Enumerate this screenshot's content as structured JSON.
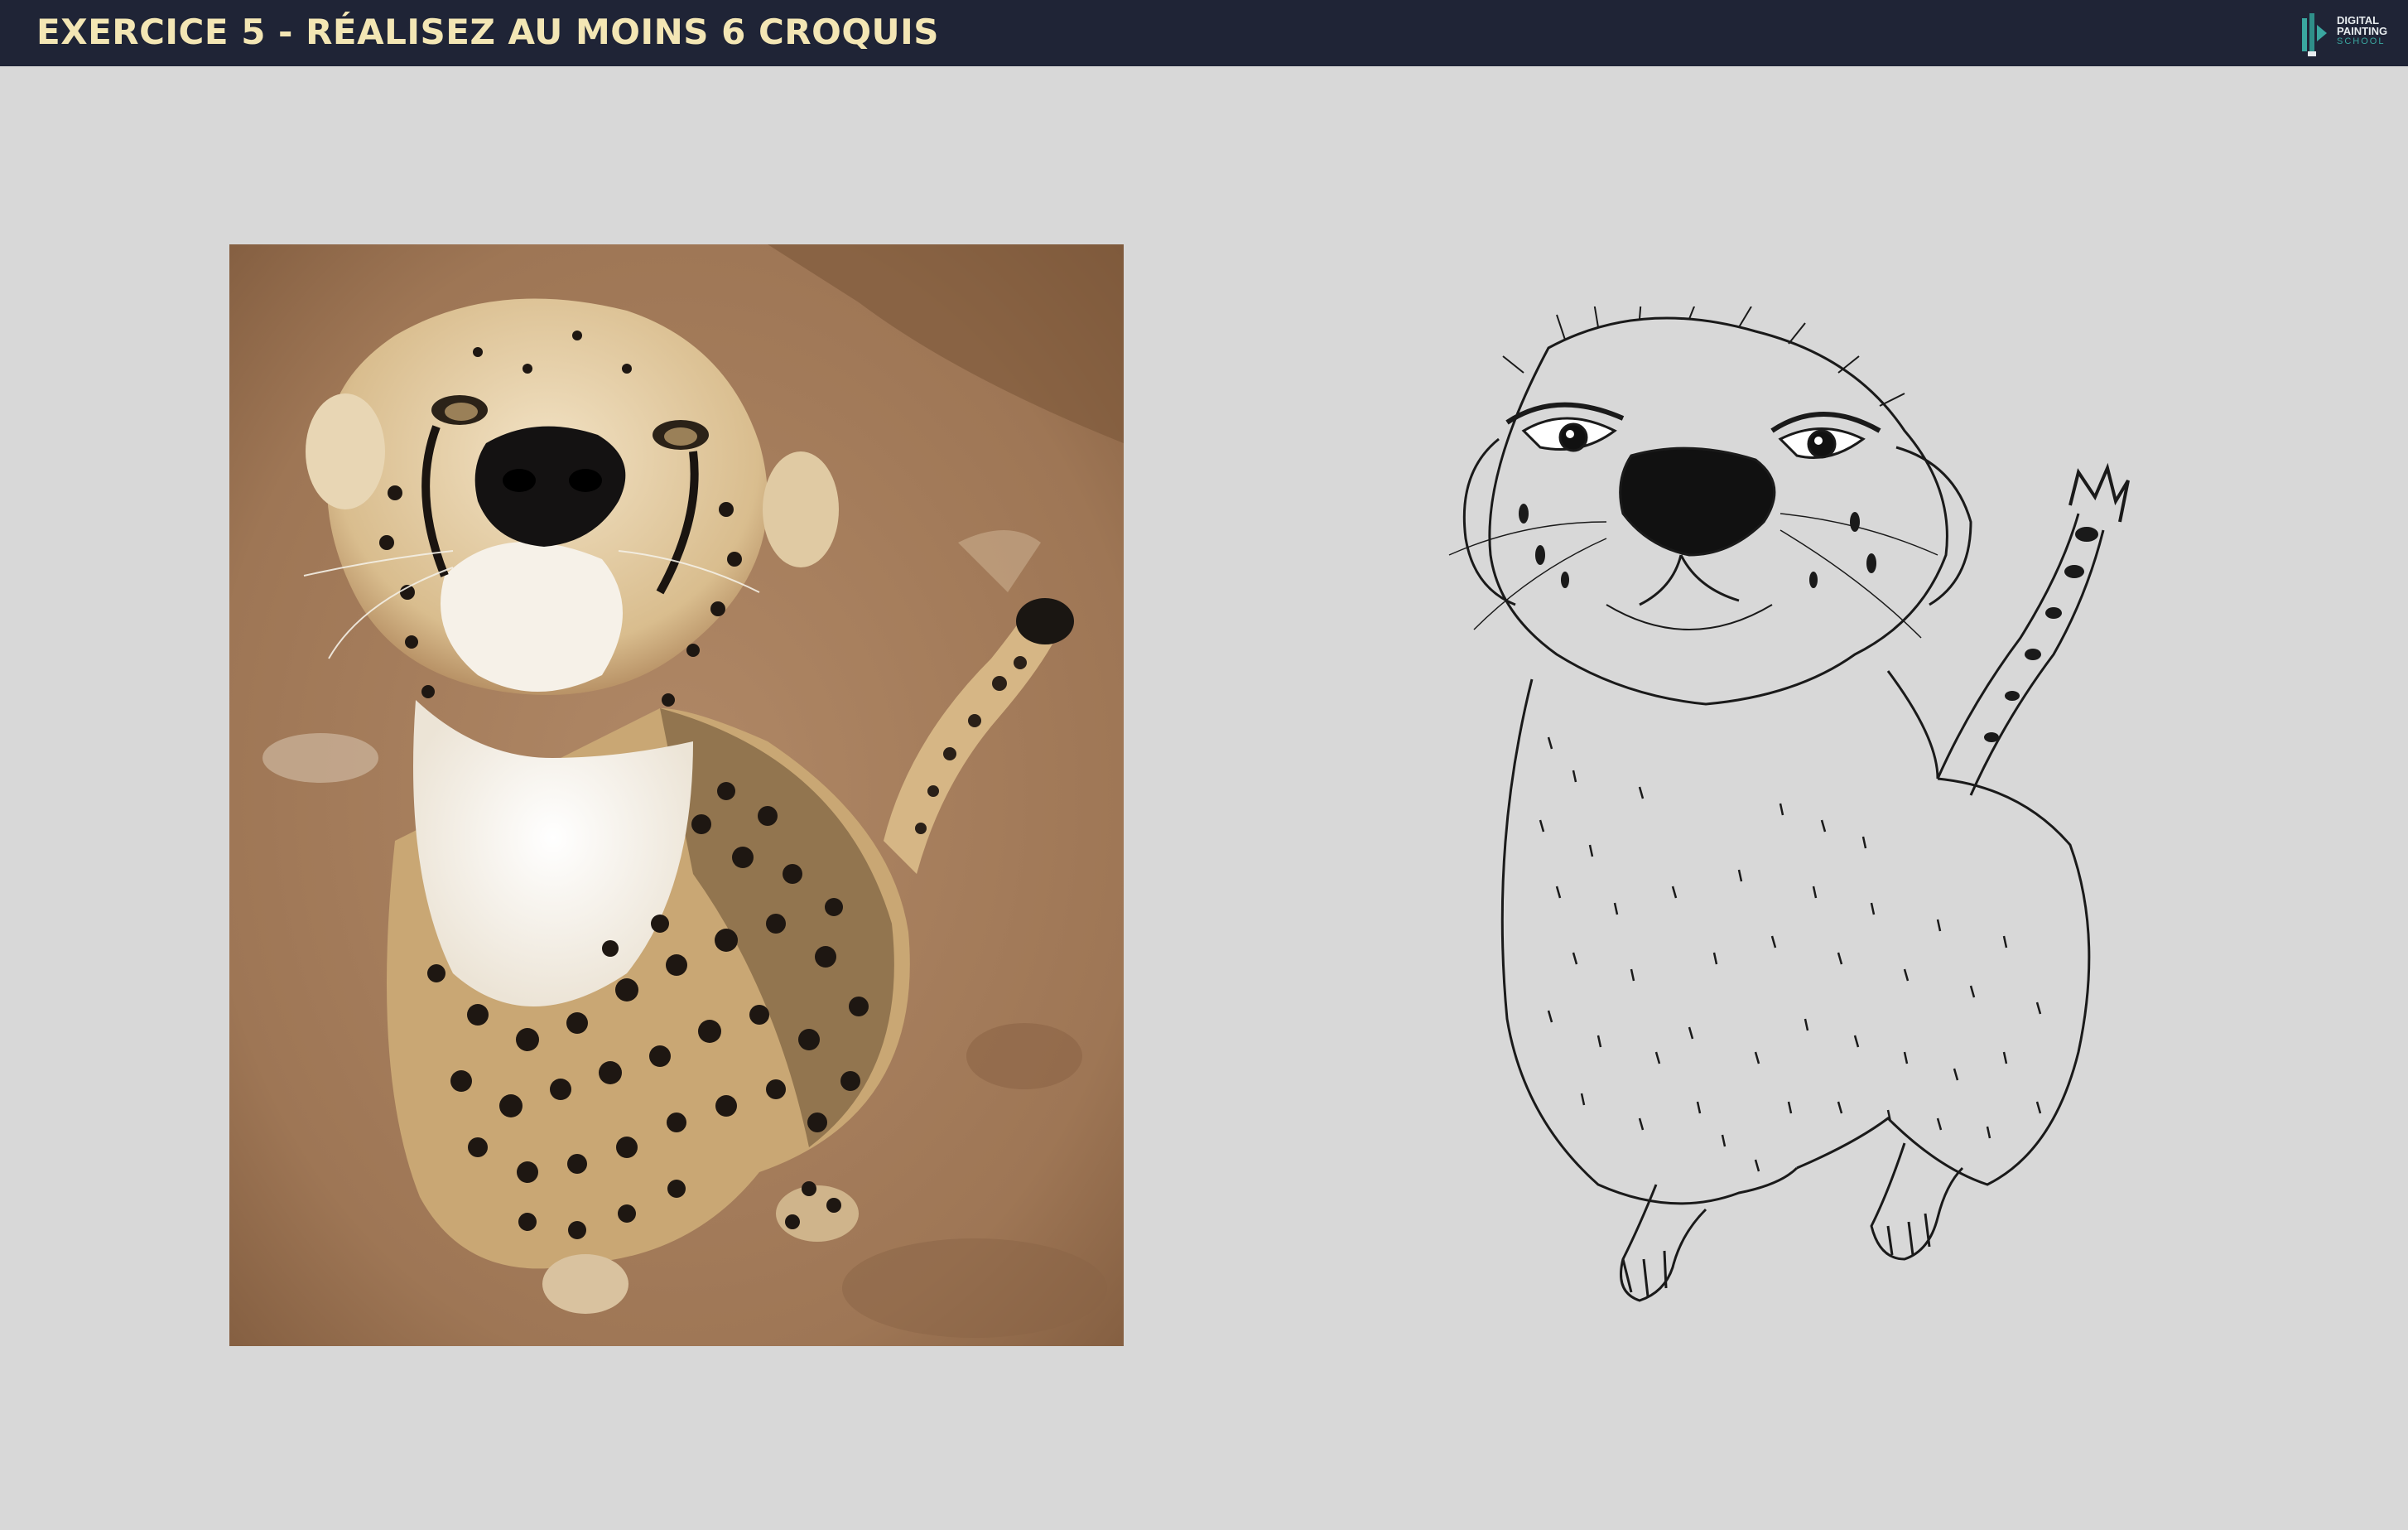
{
  "header": {
    "title": "EXERCICE 5 - RÉALISEZ AU MOINS 6 CROQUIS",
    "logo_lines": [
      "DIGITAL",
      "PAINTING",
      "SCHOOL"
    ]
  },
  "colors": {
    "topbar": "#1f2436",
    "title": "#f3e6b4",
    "background": "#d8d8d8",
    "logo_accent": "#3aa7a0"
  },
  "images": {
    "photo": "cheetah-photo",
    "sketch": "cheetah-line-sketch"
  }
}
